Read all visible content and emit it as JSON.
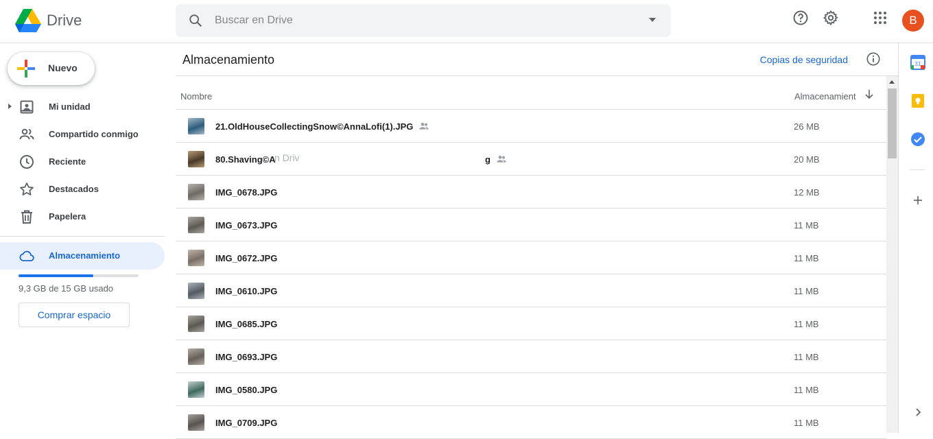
{
  "app": {
    "name": "Drive"
  },
  "search": {
    "placeholder": "Buscar en Drive"
  },
  "header": {
    "avatar_letter": "B"
  },
  "sidebar": {
    "new_label": "Nuevo",
    "items": [
      {
        "label": "Mi unidad",
        "icon": "my-drive-icon"
      },
      {
        "label": "Compartido conmigo",
        "icon": "people-icon"
      },
      {
        "label": "Reciente",
        "icon": "clock-icon"
      },
      {
        "label": "Destacados",
        "icon": "star-icon"
      },
      {
        "label": "Papelera",
        "icon": "trash-icon"
      }
    ],
    "storage_label": "Almacenamiento",
    "quota_text": "9,3 GB de 15 GB usado",
    "quota_fraction": 0.62,
    "buy_label": "Comprar espacio"
  },
  "main": {
    "title": "Almacenamiento",
    "backup_link": "Copias de seguridad",
    "columns": {
      "name": "Nombre",
      "storage": "Almacenamient"
    },
    "drag_ghost": "n Driv",
    "files": [
      {
        "name": "21.OldHouseCollectingSnow©AnnaLofi(1).JPG",
        "size": "26 MB",
        "shared": true
      },
      {
        "name": "80.Shaving©A",
        "name_tail": "g",
        "size": "20 MB",
        "shared": true
      },
      {
        "name": "IMG_0678.JPG",
        "size": "12 MB",
        "shared": false
      },
      {
        "name": "IMG_0673.JPG",
        "size": "11 MB",
        "shared": false
      },
      {
        "name": "IMG_0672.JPG",
        "size": "11 MB",
        "shared": false
      },
      {
        "name": "IMG_0610.JPG",
        "size": "11 MB",
        "shared": false
      },
      {
        "name": "IMG_0685.JPG",
        "size": "11 MB",
        "shared": false
      },
      {
        "name": "IMG_0693.JPG",
        "size": "11 MB",
        "shared": false
      },
      {
        "name": "IMG_0580.JPG",
        "size": "11 MB",
        "shared": false
      },
      {
        "name": "IMG_0709.JPG",
        "size": "11 MB",
        "shared": false
      }
    ]
  },
  "colors": {
    "accent": "#1967d2",
    "active_bg": "#e8f0fe",
    "avatar": "#e8501f"
  }
}
